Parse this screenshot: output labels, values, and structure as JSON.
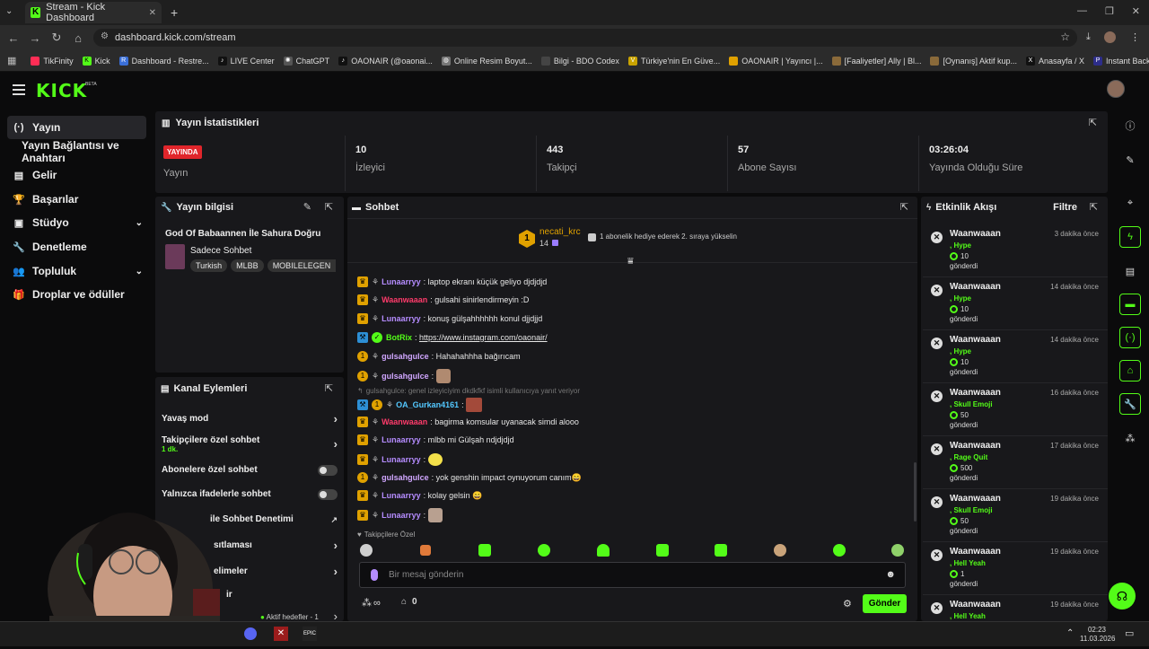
{
  "browser": {
    "tab_title": "Stream - Kick Dashboard",
    "url": "dashboard.kick.com/stream",
    "bookmarks": [
      "TikFinity",
      "Kick",
      "Dashboard - Restre...",
      "LIVE Center",
      "ChatGPT",
      "OAONAIR (@oaonai...",
      "Online Resim Boyut...",
      "Bilgi - BDO Codex",
      "Türkiye'nin En Güve...",
      "OAONAIR | Yayıncı |...",
      "[Faaliyetler] Ally | Bl...",
      "[Oynanış] Aktif kup...",
      "Anasayfa / X",
      "Instant Background..."
    ]
  },
  "header": {
    "logo": "KICK",
    "beta": "BETA"
  },
  "sidebar": {
    "items": [
      {
        "label": "Yayın",
        "icon": "broadcast-icon"
      },
      {
        "label": "Yayın Bağlantısı ve Anahtarı",
        "icon": ""
      },
      {
        "label": "Gelir",
        "icon": "revenue-icon"
      },
      {
        "label": "Başarılar",
        "icon": "trophy-icon"
      },
      {
        "label": "Stüdyo",
        "icon": "studio-icon"
      },
      {
        "label": "Denetleme",
        "icon": "wrench-icon"
      },
      {
        "label": "Topluluk",
        "icon": "community-icon"
      },
      {
        "label": "Droplar ve ödüller",
        "icon": "gift-icon"
      }
    ]
  },
  "stats": {
    "title": "Yayın İstatistikleri",
    "live_badge": "YAYINDA",
    "live_label": "Yayın",
    "viewers_value": "10",
    "viewers_label": "İzleyici",
    "followers_value": "443",
    "followers_label": "Takipçi",
    "subs_value": "57",
    "subs_label": "Abone Sayısı",
    "uptime_value": "03:26:04",
    "uptime_label": "Yayında Olduğu Süre"
  },
  "stream_info": {
    "title": "Yayın bilgisi",
    "stream_title": "God Of Babaannen İle Sahura Doğru",
    "category": "Sadece Sohbet",
    "tags": [
      "Turkish",
      "MLBB",
      "MOBILELEGEN"
    ]
  },
  "channel_actions": {
    "title": "Kanal Eylemleri",
    "slow_mode": "Yavaş mod",
    "followers_only": "Takipçilere özel sohbet",
    "followers_only_sub": "1 dk.",
    "subs_only": "Abonelere özel sohbet",
    "emotes_only": "Yalnızca ifadelerle sohbet",
    "ai_moderation": "ile Sohbet Denetimi",
    "settings": "sıtlaması",
    "rewards": "elimeler",
    "extra": "ir",
    "active_goals": "Aktif hedefler - 1"
  },
  "chat": {
    "title": "Sohbet",
    "pinned_user": "necati_krc",
    "pinned_rank": "1",
    "pinned_count": "14",
    "pinned_text": "1 abonelik hediye ederek 2. sıraya yükselin",
    "messages": [
      {
        "user": "Lunaarryy",
        "color": "#b58cff",
        "text": "laptop ekranı küçük geliyo djdjdjd",
        "badge": "crown"
      },
      {
        "user": "Waanwaaan",
        "color": "#ff3b6b",
        "text": "gulsahi sinirlendirmeyin :D",
        "badge": "crown"
      },
      {
        "user": "Lunaarryy",
        "color": "#b58cff",
        "text": "konuş gülşahhhhhh konul djjdjjd",
        "badge": "crown"
      },
      {
        "user": "BotRix",
        "color": "#53fc18",
        "text": "https://www.instagram.com/oaonair/",
        "badge": "bot"
      },
      {
        "user": "gulsahgulce",
        "color": "#d0a6ff",
        "text": "Hahahahhha bağırıcam",
        "badge": "one"
      },
      {
        "user": "gulsahgulce",
        "color": "#d0a6ff",
        "text": "",
        "badge": "one"
      },
      {
        "user": "OA_Gurkan4161",
        "color": "#53c8ff",
        "text": "",
        "badge": "bot"
      },
      {
        "user": "Waanwaaan",
        "color": "#ff3b6b",
        "text": "bagirma komsular uyanacak simdi alooo",
        "badge": "crown"
      },
      {
        "user": "Lunaarryy",
        "color": "#b58cff",
        "text": "mlbb mi Gülşah ndjdjdjd",
        "badge": "crown"
      },
      {
        "user": "Lunaarryy",
        "color": "#b58cff",
        "text": "",
        "badge": "crown"
      },
      {
        "user": "gulsahgulce",
        "color": "#d0a6ff",
        "text": "yok genshin impact oynuyorum canım😄",
        "badge": "one"
      },
      {
        "user": "Lunaarryy",
        "color": "#b58cff",
        "text": "kolay gelsin 😄",
        "badge": "crown"
      },
      {
        "user": "Lunaarryy",
        "color": "#b58cff",
        "text": "",
        "badge": "crown"
      }
    ],
    "reply_hint": "gulsahgulce: genel izleyiciyim dkdkfkf isimli kullanıcıya yanıt veriyor",
    "followers_only_label": "Takipçilere Özel",
    "input_placeholder": "Bir mesaj gönderin",
    "send_button": "Gönder",
    "points": "∞",
    "store_count": "0"
  },
  "activity": {
    "title": "Etkinlik Akışı",
    "filter": "Filtre",
    "sent_label": "gönderdi",
    "events": [
      {
        "user": "Waanwaaan",
        "time": "3 dakika önce",
        "item": ", Hype",
        "amount": "10"
      },
      {
        "user": "Waanwaaan",
        "time": "14 dakika önce",
        "item": ", Hype",
        "amount": "10"
      },
      {
        "user": "Waanwaaan",
        "time": "14 dakika önce",
        "item": ", Hype",
        "amount": "10"
      },
      {
        "user": "Waanwaaan",
        "time": "16 dakika önce",
        "item": ", Skull Emoji",
        "amount": "50"
      },
      {
        "user": "Waanwaaan",
        "time": "17 dakika önce",
        "item": ", Rage Quit",
        "amount": "500"
      },
      {
        "user": "Waanwaaan",
        "time": "19 dakika önce",
        "item": ", Skull Emoji",
        "amount": "50"
      },
      {
        "user": "Waanwaaan",
        "time": "19 dakika önce",
        "item": ", Hell Yeah",
        "amount": "1"
      },
      {
        "user": "Waanwaaan",
        "time": "19 dakika önce",
        "item": ", Hell Yeah",
        "amount": ""
      }
    ]
  },
  "taskbar": {
    "time": "02:23",
    "date": "11.03.2026"
  },
  "colors": {
    "accent": "#53fc18",
    "live": "#e0252b",
    "panel": "#18181b",
    "bg": "#0b0b0c"
  }
}
